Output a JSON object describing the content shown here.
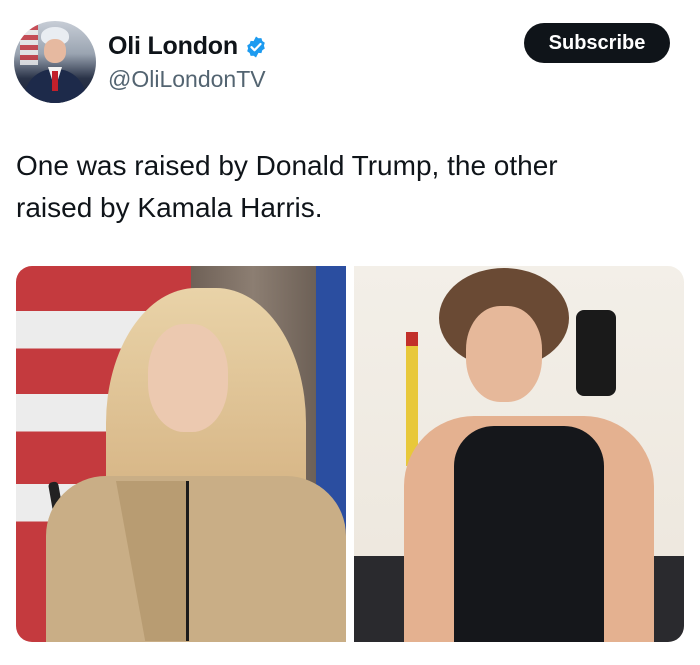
{
  "author": {
    "name": "Oli London",
    "handle": "@OliLondonTV",
    "verified": true,
    "verified_color": "#1d9bf0"
  },
  "subscribe_label": "Subscribe",
  "tweet": {
    "lines": [
      "One was raised by Donald Trump, the other",
      "raised by Kamala Harris."
    ]
  },
  "media": [
    {
      "icon": "photo-of-woman-blonde-hair-beige-coat"
    },
    {
      "icon": "photo-of-person-mirror-selfie-black-tank-top"
    }
  ]
}
